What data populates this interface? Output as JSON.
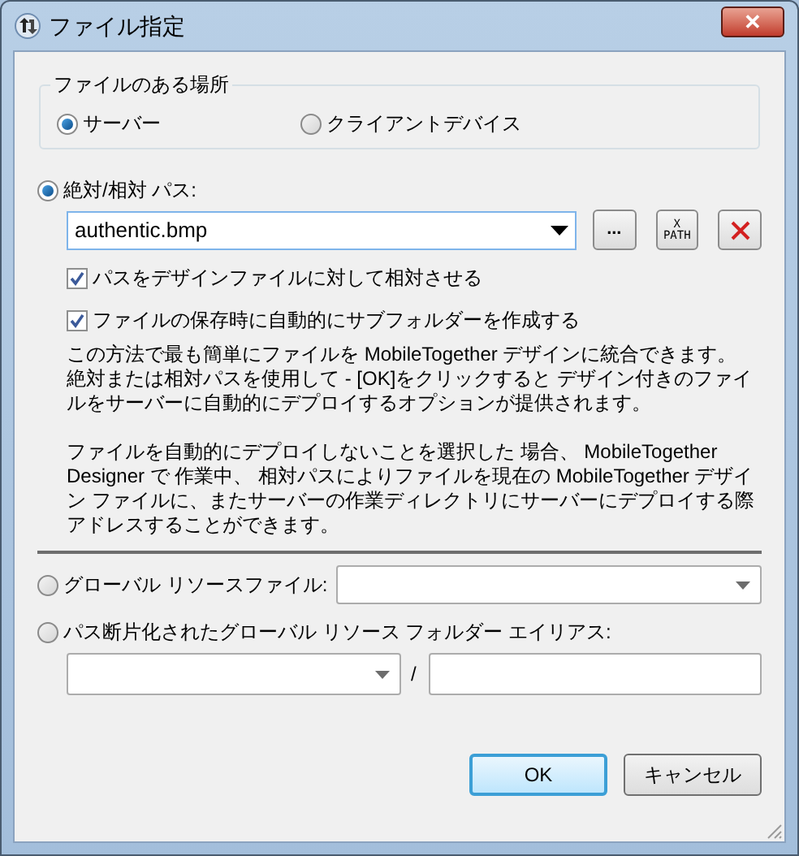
{
  "window": {
    "title": "ファイル指定",
    "close": "✕"
  },
  "location_group": {
    "title": "ファイルのある場所",
    "options": [
      {
        "label": "サーバー",
        "selected": true
      },
      {
        "label": "クライアントデバイス",
        "selected": false
      }
    ]
  },
  "sources": [
    {
      "kind": "path",
      "label": "絶対/相対 パス:",
      "selected": true,
      "value": "authentic.bmp",
      "browse": "...",
      "xpath": [
        "X",
        "PATH"
      ],
      "checkboxes": [
        {
          "label": "パスをデザインファイルに対して相対させる",
          "checked": true
        },
        {
          "label": "ファイルの保存時に自動的にサブフォルダーを作成する",
          "checked": true
        }
      ],
      "paragraphs": [
        "この方法で最も簡単にファイルを MobileTogether デザインに統合できます。絶対または相対パスを使用して - [OK]をクリックすると デザイン付きのファイルをサーバーに自動的にデプロイするオプションが提供されます。",
        "ファイルを自動的にデプロイしないことを選択した 場合、 MobileTogether Designer で 作業中、 相対パスによりファイルを現在の MobileTogether デザイン ファイルに、またサーバーの作業ディレクトリにサーバーにデプロイする際アドレスすることができます。"
      ]
    },
    {
      "kind": "global_file",
      "label": "グローバル リソースファイル:",
      "selected": false
    },
    {
      "kind": "global_alias",
      "label": "パス断片化されたグローバル リソース フォルダー エイリアス:",
      "selected": false,
      "separator": "/"
    }
  ],
  "buttons": [
    {
      "label": "OK",
      "default": true
    },
    {
      "label": "キャンセル",
      "default": false
    }
  ]
}
